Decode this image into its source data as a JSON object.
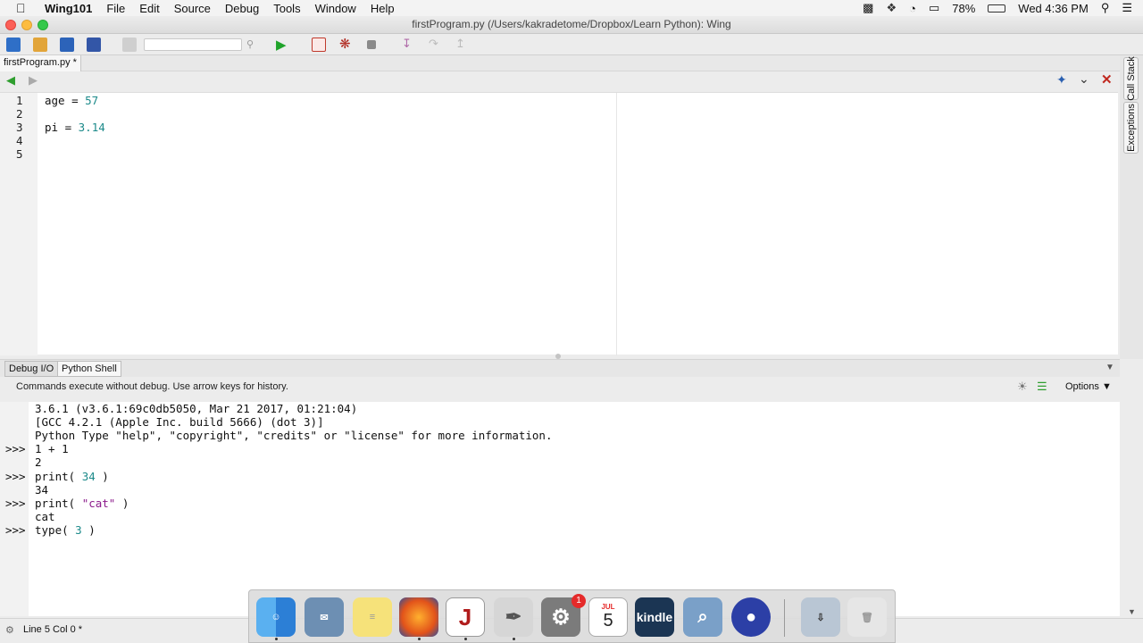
{
  "menubar": {
    "app_name": "Wing101",
    "items": [
      "File",
      "Edit",
      "Source",
      "Debug",
      "Tools",
      "Window",
      "Help"
    ],
    "battery": "78%",
    "clock": "Wed 4:36 PM"
  },
  "window": {
    "title": "firstProgram.py (/Users/kakradetome/Dropbox/Learn Python): Wing"
  },
  "editor": {
    "tab_label": "firstProgram.py *",
    "line_numbers": [
      "1",
      "2",
      "3",
      "4",
      "5"
    ],
    "lines": [
      {
        "ident": "age",
        "op": " = ",
        "value": "57"
      },
      {
        "ident": "",
        "op": "",
        "value": ""
      },
      {
        "ident": "pi",
        "op": " = ",
        "value": "3.14"
      },
      {
        "ident": "",
        "op": "",
        "value": ""
      },
      {
        "ident": "",
        "op": "",
        "value": ""
      }
    ]
  },
  "side_tabs": {
    "call_stack": "Call Stack",
    "exceptions": "Exceptions"
  },
  "shell": {
    "tabs": [
      "Debug I/O",
      "Python Shell"
    ],
    "info": "Commands execute without debug.  Use arrow keys for history.",
    "options_label": "Options",
    "banner": [
      "3.6.1 (v3.6.1:69c0db5050, Mar 21 2017, 01:21:04)",
      "[GCC 4.2.1 (Apple Inc. build 5666) (dot 3)]",
      "Python Type \"help\", \"copyright\", \"credits\" or \"license\" for more information."
    ],
    "prompt": ">>>",
    "history": [
      {
        "input_a": "1 + 1",
        "input_str": "",
        "input_b": "",
        "output": "2"
      },
      {
        "input_a": "print( ",
        "input_str": "34",
        "input_b": " )",
        "output": "34"
      },
      {
        "input_a": "print( ",
        "input_str": "\"cat\"",
        "input_b": " )",
        "output": "cat"
      },
      {
        "input_a": "type( ",
        "input_str": "3",
        "input_b": " )",
        "output": ""
      }
    ]
  },
  "status": {
    "position": "Line 5 Col 0 *"
  },
  "dock": {
    "kindle_label": "kindle",
    "calendar_month": "JUL",
    "calendar_day": "5",
    "badge": "1"
  },
  "colors": {
    "number": "#1c8a8a",
    "string": "#8b1a8b",
    "close_red": "#fc5f57",
    "min_yellow": "#fdbc40",
    "max_green": "#34c84a"
  }
}
